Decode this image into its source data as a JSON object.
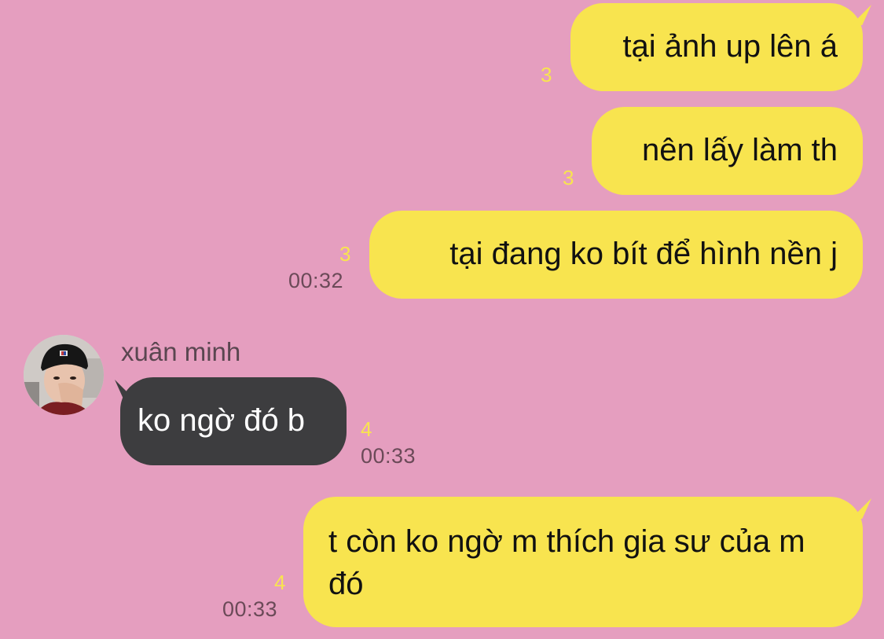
{
  "colors": {
    "background": "#e59ebf",
    "outgoing_bubble": "#f8e44f",
    "incoming_bubble": "#3d3d3f",
    "count_text": "#f8e44f",
    "time_text": "#6b4a58"
  },
  "messages": [
    {
      "direction": "outgoing",
      "text": "tại ảnh up lên á",
      "read_count": "3",
      "time": ""
    },
    {
      "direction": "outgoing",
      "text": "nên lấy làm th",
      "read_count": "3",
      "time": ""
    },
    {
      "direction": "outgoing",
      "text": "tại đang ko bít để hình nền j",
      "read_count": "3",
      "time": "00:32"
    },
    {
      "direction": "incoming",
      "sender": "xuân minh",
      "avatar": "avatar-photo",
      "text": "ko ngờ đó b",
      "read_count": "4",
      "time": "00:33"
    },
    {
      "direction": "outgoing",
      "text": "t còn ko ngờ m thích gia sư của m đó",
      "read_count": "4",
      "time": "00:33"
    }
  ]
}
